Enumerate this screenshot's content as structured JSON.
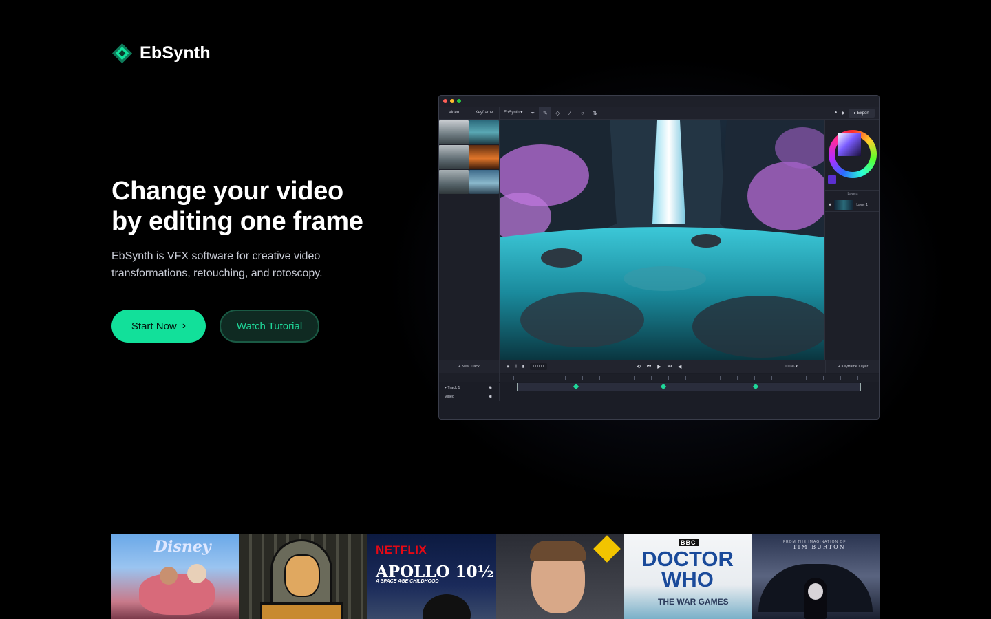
{
  "brand": {
    "name": "EbSynth",
    "accent": "#12e09a"
  },
  "hero": {
    "title_line1": "Change your video",
    "title_line2": "by editing one frame",
    "description": "EbSynth is VFX software for creative video transformations, retouching, and rotoscopy.",
    "primary_cta": "Start Now",
    "secondary_cta": "Watch Tutorial"
  },
  "app": {
    "tabs": [
      "Video",
      "Keyframe"
    ],
    "mode_dropdown": "EbSynth",
    "export_label": "Export",
    "layers_label": "Layers",
    "layer_name": "Layer 1",
    "new_track": "New Track",
    "frame_counter": "00000",
    "zoom": "100%",
    "keyframe_layer": "Keyframe Layer",
    "tracks": [
      "Track 1",
      "Video"
    ]
  },
  "showcase": [
    {
      "name": "disney",
      "label": "Disney"
    },
    {
      "name": "animated-knight",
      "label": ""
    },
    {
      "name": "netflix-apollo",
      "label": "NETFLIX",
      "title": "APOLLO 10½",
      "subtitle": "A SPACE AGE CHILDHOOD"
    },
    {
      "name": "3d-face",
      "label": ""
    },
    {
      "name": "doctor-who",
      "label": "BBC",
      "title": "DOCTOR WHO",
      "subtitle": "THE WAR GAMES"
    },
    {
      "name": "wednesday",
      "label": "FROM THE IMAGINATION OF",
      "title": "TIM BURTON"
    }
  ]
}
